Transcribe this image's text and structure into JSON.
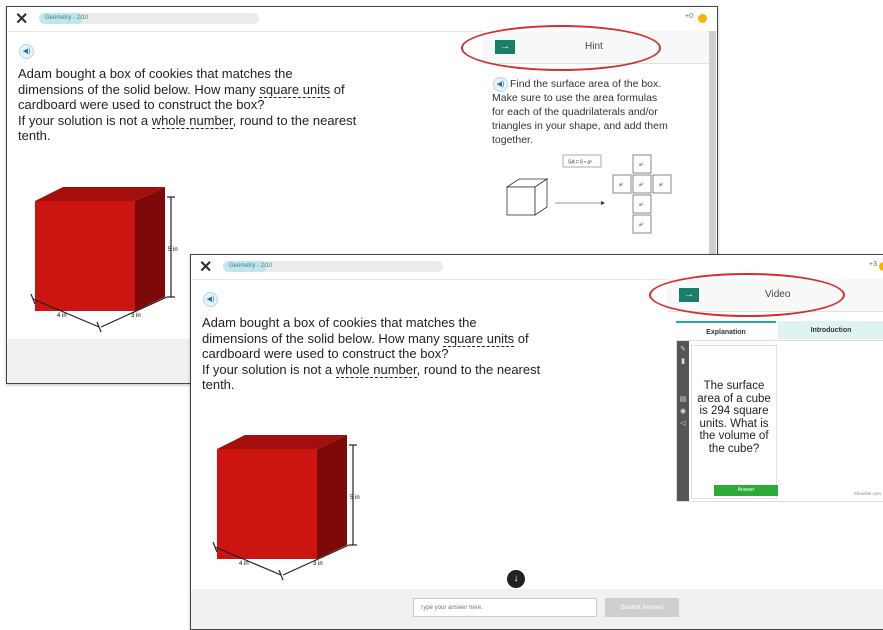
{
  "window1": {
    "close_label": "✕",
    "progress_label": "Geometry - 2/10",
    "progress_fraction": 0.2,
    "score": "+0",
    "question_lines": [
      [
        "Adam bought a box of cookies that matches the"
      ],
      [
        "dimensions of the solid below. How many ",
        "square units",
        " of"
      ],
      [
        "cardboard were used to construct the box?"
      ],
      [
        "If your solution is not a ",
        "whole number",
        ", round to the nearest"
      ],
      [
        "tenth."
      ]
    ],
    "cube_labels": {
      "height": "5 in",
      "width": "4 in",
      "depth": "3 in"
    },
    "hint_panel": {
      "arrow": "→",
      "title": "Hint",
      "lines": [
        "Find the surface area of the box.",
        "Make sure to use the area formulas",
        "for each of the quadrilaterals and/or",
        "triangles in your shape, and add them",
        "together."
      ],
      "formula": "SA = 6 • a²",
      "net_label": "a²"
    }
  },
  "window2": {
    "close_label": "✕",
    "progress_label": "Geometry - 2/10",
    "progress_fraction": 0.2,
    "score": "+3",
    "question_lines": [
      [
        "Adam bought a box of cookies that matches the"
      ],
      [
        "dimensions of the solid below. How many ",
        "square units",
        " of"
      ],
      [
        "cardboard were used to construct the box?"
      ],
      [
        "If your solution is not a ",
        "whole number",
        ", round to the nearest"
      ],
      [
        "tenth."
      ]
    ],
    "cube_labels": {
      "height": "5 in",
      "width": "4 in",
      "depth": "3 in"
    },
    "video_panel": {
      "arrow": "→",
      "title": "Video",
      "tabs": [
        "Explanation",
        "Introduction"
      ],
      "card_text": [
        "The surface",
        "area of a cube",
        "is 294 square",
        "units.  What is",
        "the volume of",
        "the cube?"
      ],
      "card_button": "Answer",
      "brand": "ShowMe.com"
    },
    "down_arrow": "↓",
    "answer_placeholder": "Type your answer here.",
    "submit_label": "Submit Answer"
  },
  "colors": {
    "accent_green": "#1a7f67",
    "oval_red": "#d32f2f",
    "cube_front": "#cc1510",
    "cube_top": "#a30f0c",
    "cube_side": "#7d0a08",
    "progress_fill": "#bfe7e9"
  },
  "icons": [
    "close-icon",
    "speaker-icon",
    "arrow-right-icon",
    "coin-icon",
    "down-arrow-icon"
  ]
}
